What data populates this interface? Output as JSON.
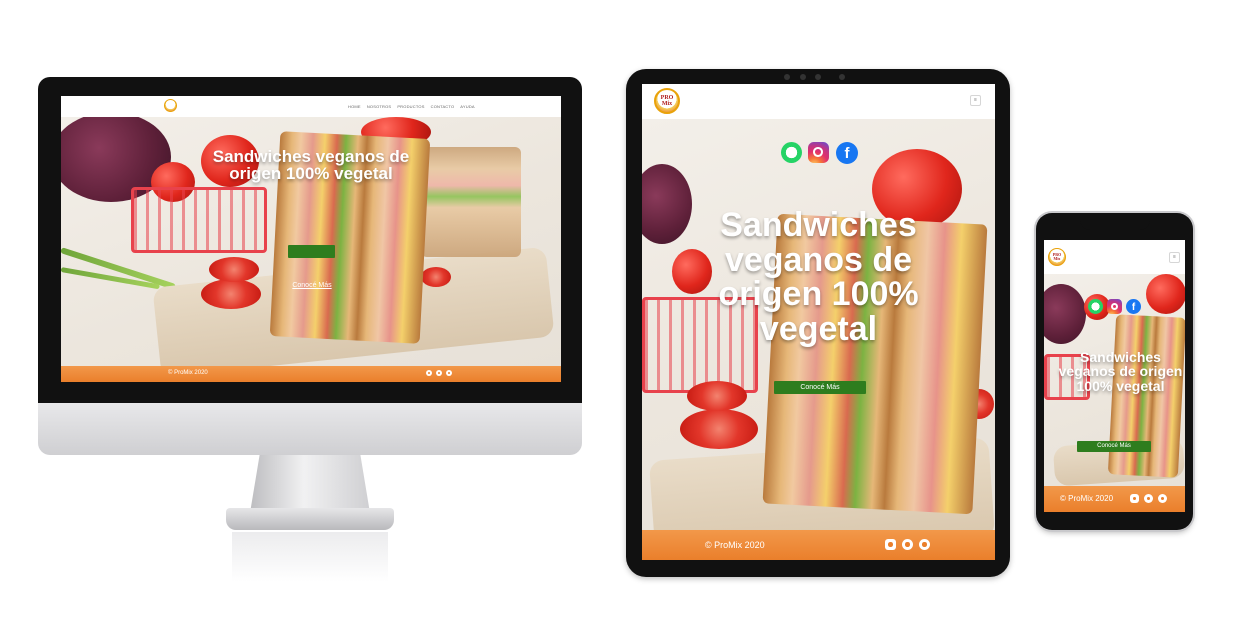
{
  "brand": {
    "logo_text": "PRO\nMix"
  },
  "nav": {
    "items": [
      "HOME",
      "NOSOTROS",
      "PRODUCTOS",
      "CONTACTO",
      "AYUDA"
    ]
  },
  "hero": {
    "desktop_title": "Sandwiches veganos de origen 100% vegetal",
    "cta_label": "Conocé Más"
  },
  "footer": {
    "copyright": "© ProMix 2020"
  },
  "social": [
    "whatsapp-icon",
    "instagram-icon",
    "facebook-icon"
  ],
  "colors": {
    "footer_orange": "#ea7f2b",
    "cta_green": "#2e7d1e",
    "whatsapp": "#25d366",
    "facebook": "#1877f2"
  }
}
